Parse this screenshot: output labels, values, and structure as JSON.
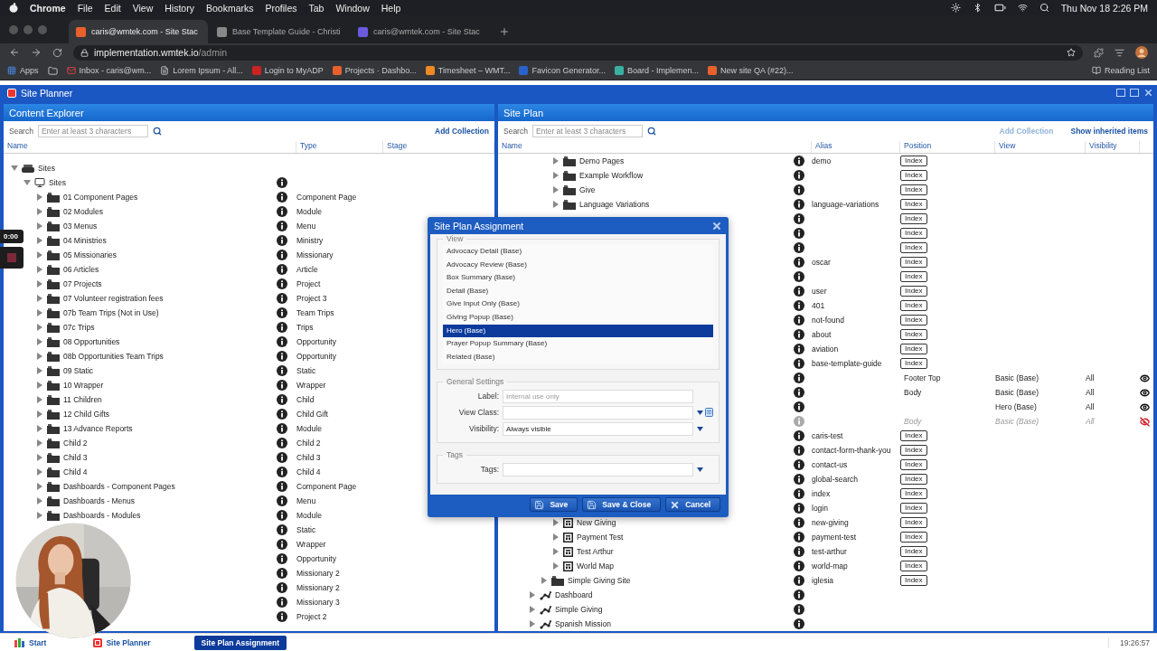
{
  "menubar": {
    "app": "Chrome",
    "menus": [
      "File",
      "Edit",
      "View",
      "History",
      "Bookmarks",
      "Profiles",
      "Tab",
      "Window",
      "Help"
    ],
    "clock": "Thu Nov 18  2:26 PM"
  },
  "browser": {
    "tabs": [
      {
        "title": "caris@wmtek.com - Site Stac",
        "selected": true
      },
      {
        "title": "Base Template Guide - Christi",
        "selected": false
      },
      {
        "title": "caris@wmtek.com - Site Stac",
        "selected": false
      }
    ],
    "host": "implementation.wmtek.io",
    "path": "/admin",
    "bookmarks": [
      {
        "label": "Apps",
        "kind": "apps"
      },
      {
        "kind": "folder"
      },
      {
        "label": "Inbox - caris@wm...",
        "kind": "mail"
      },
      {
        "label": "Lorem Ipsum - All...",
        "kind": "page"
      },
      {
        "label": "Login to MyADP",
        "kind": "adp"
      },
      {
        "label": "Projects · Dashbo...",
        "kind": "fox"
      },
      {
        "label": "Timesheet – WMT...",
        "kind": "h"
      },
      {
        "label": "Favicon Generator...",
        "kind": "r"
      },
      {
        "label": "Board - Implemen...",
        "kind": "board"
      },
      {
        "label": "New site QA (#22)...",
        "kind": "fox"
      }
    ],
    "reading_list": "Reading List"
  },
  "app": {
    "title": "Site Planner"
  },
  "explorer": {
    "title": "Content Explorer",
    "search_label": "Search",
    "search_placeholder": "Enter at least 3 characters",
    "action": "Add Collection",
    "columns": [
      "Name",
      "Type",
      "Stage"
    ],
    "tree": [
      {
        "name": "Sites",
        "kind": "root",
        "expanded": true,
        "children": [
          {
            "name": "Sites",
            "kind": "site",
            "expanded": true,
            "children": [
              {
                "name": "01 Component Pages",
                "kind": "folder",
                "expanded": false,
                "type": "Component Page"
              },
              {
                "name": "02 Modules",
                "kind": "folder",
                "expanded": false,
                "type": "Module"
              },
              {
                "name": "03 Menus",
                "kind": "folder",
                "expanded": false,
                "type": "Menu"
              },
              {
                "name": "04 Ministries",
                "kind": "folder",
                "expanded": false,
                "type": "Ministry"
              },
              {
                "name": "05 Missionaries",
                "kind": "folder",
                "expanded": false,
                "type": "Missionary"
              },
              {
                "name": "06 Articles",
                "kind": "folder",
                "expanded": false,
                "type": "Article"
              },
              {
                "name": "07 Projects",
                "kind": "folder",
                "expanded": false,
                "type": "Project"
              },
              {
                "name": "07 Volunteer registration fees",
                "kind": "folder",
                "expanded": false,
                "type": "Project 3"
              },
              {
                "name": "07b Team Trips (Not in Use)",
                "kind": "folder",
                "expanded": false,
                "type": "Team Trips"
              },
              {
                "name": "07c Trips",
                "kind": "folder",
                "expanded": false,
                "type": "Trips"
              },
              {
                "name": "08 Opportunities",
                "kind": "folder",
                "expanded": false,
                "type": "Opportunity"
              },
              {
                "name": "08b Opportunities Team Trips",
                "kind": "folder",
                "expanded": false,
                "type": "Opportunity"
              },
              {
                "name": "09 Static",
                "kind": "folder",
                "expanded": false,
                "type": "Static"
              },
              {
                "name": "10 Wrapper",
                "kind": "folder",
                "expanded": false,
                "type": "Wrapper"
              },
              {
                "name": "11 Children",
                "kind": "folder",
                "expanded": false,
                "type": "Child"
              },
              {
                "name": "12 Child Gifts",
                "kind": "folder",
                "expanded": false,
                "type": "Child Gift"
              },
              {
                "name": "13 Advance Reports",
                "kind": "folder",
                "expanded": false,
                "type": "Module"
              },
              {
                "name": "Child 2",
                "kind": "folder",
                "expanded": false,
                "type": "Child 2"
              },
              {
                "name": "Child 3",
                "kind": "folder",
                "expanded": false,
                "type": "Child 3"
              },
              {
                "name": "Child 4",
                "kind": "folder",
                "expanded": false,
                "type": "Child 4"
              },
              {
                "name": "Dashboards - Component Pages",
                "kind": "folder",
                "expanded": false,
                "type": "Component Page"
              },
              {
                "name": "Dashboards - Menus",
                "kind": "folder",
                "expanded": false,
                "type": "Menu"
              },
              {
                "name": "Dashboards - Modules",
                "kind": "folder",
                "expanded": false,
                "type": "Module"
              },
              {
                "type": "Static"
              },
              {
                "type": "Wrapper"
              },
              {
                "type": "Opportunity"
              },
              {
                "type": "Missionary 2"
              },
              {
                "type": "Missionary 2"
              },
              {
                "type": "Missionary 3"
              },
              {
                "type": "Project 2"
              }
            ]
          }
        ]
      }
    ]
  },
  "plan": {
    "title": "Site Plan",
    "search_label": "Search",
    "search_placeholder": "Enter at least 3 characters",
    "actions": [
      {
        "label": "Add Collection",
        "disabled": true
      },
      {
        "label": "Show inherited items",
        "disabled": false
      }
    ],
    "columns": [
      "Name",
      "Alias",
      "Position",
      "View",
      "Visibility"
    ],
    "tree": [
      {
        "children": [
          {
            "children": [
              {
                "name": "Demo Pages",
                "kind": "folder",
                "expanded": false,
                "alias": "demo",
                "position_button": "Index"
              },
              {
                "name": "Example Workflow",
                "kind": "folder",
                "expanded": false,
                "position_button": "Index"
              },
              {
                "name": "Give",
                "kind": "folder",
                "expanded": false,
                "position_button": "Index"
              },
              {
                "name": "Language Variations",
                "kind": "folder",
                "expanded": false,
                "alias": "language-variations",
                "position_button": "Index"
              },
              {
                "position_button": "Index"
              },
              {
                "position_button": "Index"
              },
              {
                "position_button": "Index"
              },
              {
                "alias": "oscar",
                "position_button": "Index"
              },
              {
                "position_button": "Index"
              },
              {
                "alias": "user",
                "position_button": "Index"
              },
              {
                "alias": "401",
                "position_button": "Index"
              },
              {
                "alias": "not-found",
                "position_button": "Index"
              },
              {
                "alias": "about",
                "position_button": "Index"
              },
              {
                "alias": "aviation",
                "position_button": "Index"
              },
              {
                "alias": "base-template-guide",
                "position_button": "Index"
              },
              {
                "position": "Footer Top",
                "view": "Basic (Base)",
                "visibility": "All",
                "visible": true
              },
              {
                "position": "Body",
                "view": "Basic (Base)",
                "visibility": "All",
                "visible": true
              },
              {
                "view": "Hero (Base)",
                "visibility": "All",
                "visible": true
              },
              {
                "kind": "inherited",
                "position": "Body",
                "view": "Basic (Base)",
                "visibility": "All",
                "visible": false
              },
              {
                "alias": "caris-test",
                "position_button": "Index"
              },
              {
                "alias": "contact-form-thank-you",
                "position_button": "Index"
              },
              {
                "alias": "contact-us",
                "position_button": "Index"
              },
              {
                "alias": "global-search",
                "position_button": "Index"
              },
              {
                "alias": "index",
                "position_button": "Index"
              },
              {
                "alias": "login",
                "position_button": "Index"
              },
              {
                "name": "New Giving",
                "kind": "page",
                "expanded": false,
                "alias": "new-giving",
                "position_button": "Index"
              },
              {
                "name": "Payment Test",
                "kind": "page",
                "expanded": false,
                "alias": "payment-test",
                "position_button": "Index"
              },
              {
                "name": "Test Arthur",
                "kind": "page",
                "expanded": false,
                "alias": "test-arthur",
                "position_button": "Index"
              },
              {
                "name": "World Map",
                "kind": "page",
                "expanded": false,
                "alias": "world-map",
                "position_button": "Index"
              }
            ]
          },
          {
            "name": "Simple Giving Site",
            "kind": "folder",
            "expanded": false,
            "alias": "iglesia",
            "position_button": "Index"
          }
        ]
      },
      {
        "name": "Dashboard",
        "kind": "link",
        "expanded": false
      },
      {
        "name": "Simple Giving",
        "kind": "link",
        "expanded": false
      },
      {
        "name": "Spanish Mission",
        "kind": "link",
        "expanded": false
      }
    ]
  },
  "dialog": {
    "title": "Site Plan Assignment",
    "view_legend": "View",
    "views": [
      {
        "label": "Advocacy Detail (Base)",
        "selected": false
      },
      {
        "label": "Advocacy Review (Base)",
        "selected": false
      },
      {
        "label": "Box Summary (Base)",
        "selected": false
      },
      {
        "label": "Detail (Base)",
        "selected": false
      },
      {
        "label": "Give Input Only (Base)",
        "selected": false
      },
      {
        "label": "Giving Popup (Base)",
        "selected": false
      },
      {
        "label": "Hero (Base)",
        "selected": true
      },
      {
        "label": "Prayer Popup Summary (Base)",
        "selected": false
      },
      {
        "label": "Related (Base)",
        "selected": false
      }
    ],
    "sections": [
      {
        "legend": "General Settings",
        "fields": [
          {
            "label": "Label:",
            "kind": "text",
            "placeholder": "Internal use only"
          },
          {
            "label": "View Class:",
            "kind": "combo"
          },
          {
            "label": "Visibility:",
            "kind": "select",
            "value": "Always visible"
          }
        ]
      },
      {
        "legend": "Tags",
        "fields": [
          {
            "label": "Tags:",
            "kind": "select"
          }
        ]
      }
    ],
    "buttons": [
      {
        "label": "Save",
        "kind": "save"
      },
      {
        "label": "Save & Close",
        "kind": "save"
      },
      {
        "label": "Cancel",
        "kind": "cancel"
      }
    ]
  },
  "recorder": {
    "timer": "0:00"
  },
  "taskbar": {
    "start": "Start",
    "items": [
      {
        "label": "Site Planner",
        "kind": "app",
        "selected": false
      },
      {
        "label": "Site Plan Assignment",
        "kind": "dialog",
        "selected": true
      }
    ],
    "time": "19:26:57"
  }
}
